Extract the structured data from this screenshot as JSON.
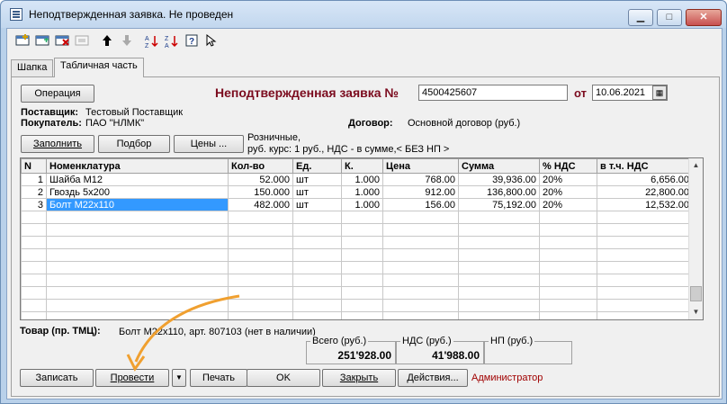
{
  "window": {
    "title": "Неподтвержденная заявка. Не проведен",
    "min": "▁",
    "max": "□",
    "close": "✕"
  },
  "toolbar": {
    "icons": [
      "new-icon",
      "copy-icon",
      "delete-icon",
      "edit-icon",
      "move-up-icon",
      "move-down-icon",
      "sort-asc-icon",
      "sort-desc-icon",
      "help-icon",
      "select-icon"
    ]
  },
  "tabs": [
    {
      "label": "Шапка"
    },
    {
      "label": "Табличная часть"
    }
  ],
  "header": {
    "operation_btn": "Операция",
    "doc_title": "Неподтвержденная заявка №",
    "number": "4500425607",
    "from_label": "от",
    "date": "10.06.2021",
    "supplier_label": "Поставщик:",
    "supplier": "Тестовый Поставщик",
    "buyer_label": "Покупатель:",
    "buyer": "ПАО \"НЛМК\"",
    "contract_label": "Договор:",
    "contract": "Основной договор (руб.)",
    "fill_btn": "Заполнить",
    "select_btn": "Подбор",
    "prices_btn": "Цены ...",
    "price_info_1": "Розничные,",
    "price_info_2": "руб. курс: 1 руб., НДС - в сумме,< БЕЗ НП >"
  },
  "table": {
    "columns": [
      "N",
      "Номенклатура",
      "Кол-во",
      "Ед.",
      "К.",
      "Цена",
      "Сумма",
      "% НДС",
      "в т.ч. НДС"
    ],
    "rows": [
      [
        "1",
        "Шайба М12",
        "52.000",
        "шт",
        "1.000",
        "768.00",
        "39,936.00",
        "20%",
        "6,656.00"
      ],
      [
        "2",
        "Гвоздь 5х200",
        "150.000",
        "шт",
        "1.000",
        "912.00",
        "136,800.00",
        "20%",
        "22,800.00"
      ],
      [
        "3",
        "Болт М22х110",
        "482.000",
        "шт",
        "1.000",
        "156.00",
        "75,192.00",
        "20%",
        "12,532.00"
      ]
    ]
  },
  "item_info": {
    "label": "Товар (пр. ТМЦ):",
    "value": "Болт М22х110, арт. 807103 (нет в наличии)"
  },
  "totals": {
    "total_label": "Всего (руб.)",
    "total": "251'928.00",
    "vat_label": "НДС (руб.)",
    "vat": "41'988.00",
    "np_label": "НП (руб.)",
    "np": ""
  },
  "footer": {
    "save_btn": "Записать",
    "post_btn": "Провести",
    "print_btn": "Печать",
    "ok_btn": "OK",
    "close_btn": "Закрыть",
    "actions_btn": "Действия...",
    "user": "Администратор"
  },
  "colors": {
    "accent_title": "#7b0b1e",
    "selection": "#3399ff",
    "arrow": "#f0a030"
  }
}
